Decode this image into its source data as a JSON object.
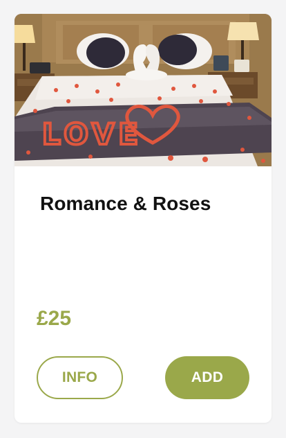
{
  "product": {
    "image_alt": "Hotel bed decorated with rose petals spelling LOVE and towel swans",
    "image_text": "LOVE",
    "title": "Romance & Roses",
    "price": "£25",
    "info_label": "INFO",
    "add_label": "ADD"
  },
  "colors": {
    "accent": "#9aa84a",
    "title": "#111111",
    "card_bg": "#ffffff",
    "page_bg": "#f4f4f5"
  }
}
